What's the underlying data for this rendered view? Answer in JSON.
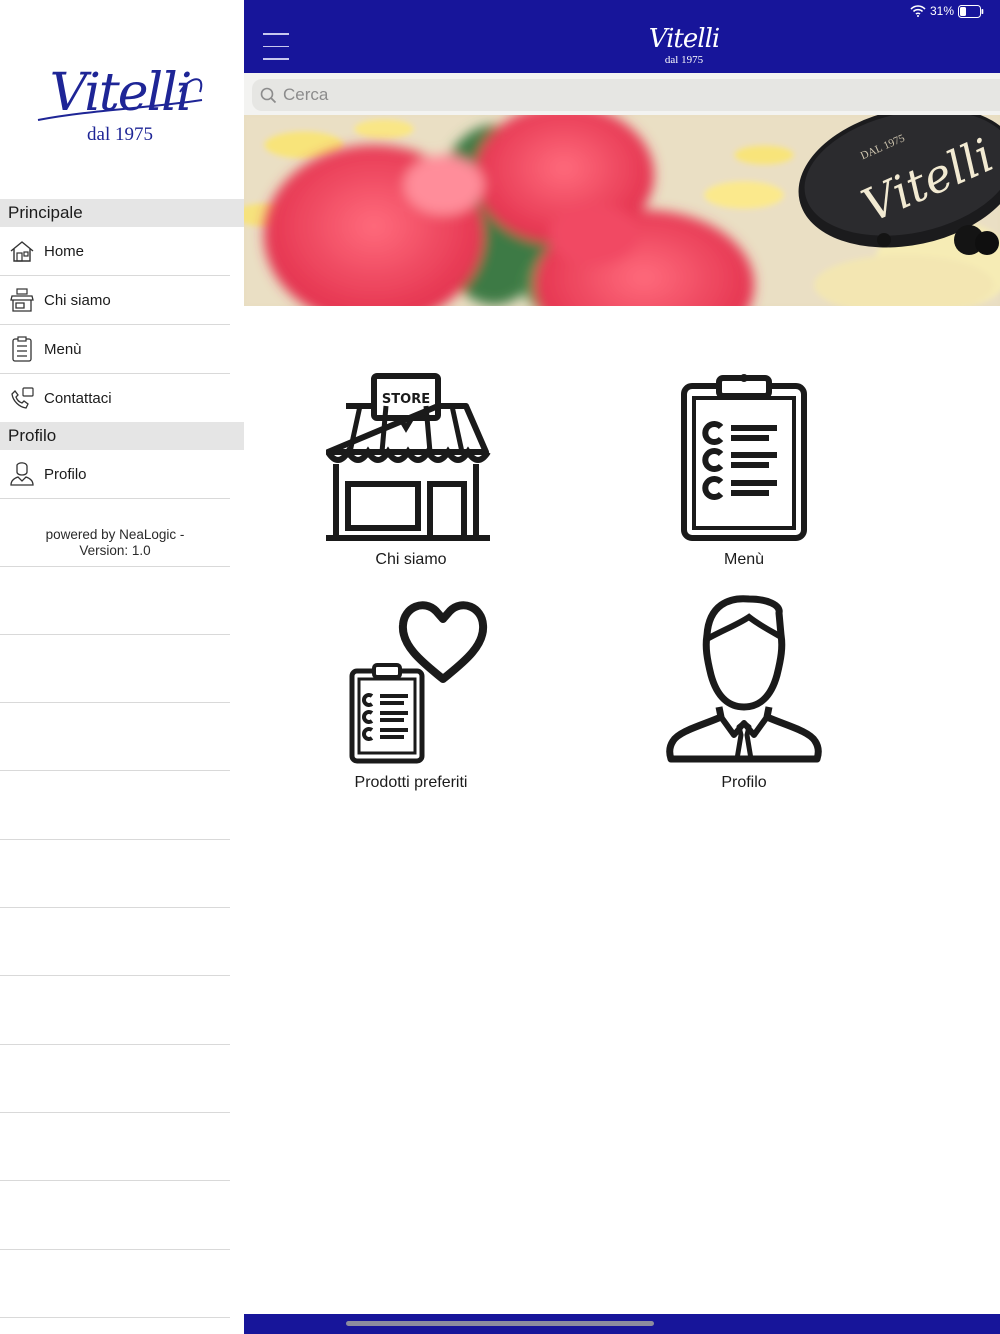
{
  "app": {
    "brand": "Vitelli",
    "since": "dal 1975"
  },
  "status": {
    "battery": "31%"
  },
  "sidebar": {
    "sections": [
      {
        "title": "Principale",
        "items": [
          {
            "label": "Home",
            "icon": "house-icon"
          },
          {
            "label": "Chi siamo",
            "icon": "store-icon"
          },
          {
            "label": "Menù",
            "icon": "clipboard-icon"
          },
          {
            "label": "Contattaci",
            "icon": "phone-icon"
          }
        ]
      },
      {
        "title": "Profilo",
        "items": [
          {
            "label": "Profilo",
            "icon": "user-icon"
          }
        ]
      }
    ],
    "powered_by": "powered by NeaLogic -",
    "version": "Version: 1.0"
  },
  "search": {
    "placeholder": "Cerca"
  },
  "tiles": [
    {
      "label": "Chi siamo",
      "icon": "store-icon",
      "badge": "STORE"
    },
    {
      "label": "Menù",
      "icon": "clipboard-icon"
    },
    {
      "label": "Prodotti preferiti",
      "icon": "favorites-icon"
    },
    {
      "label": "Profilo",
      "icon": "user-icon"
    }
  ],
  "banner": {
    "plaque": "Vitelli",
    "plaque_small": "DAL 1975"
  },
  "colors": {
    "brand_blue": "#17159a",
    "section_bg": "#e5e5e5"
  }
}
